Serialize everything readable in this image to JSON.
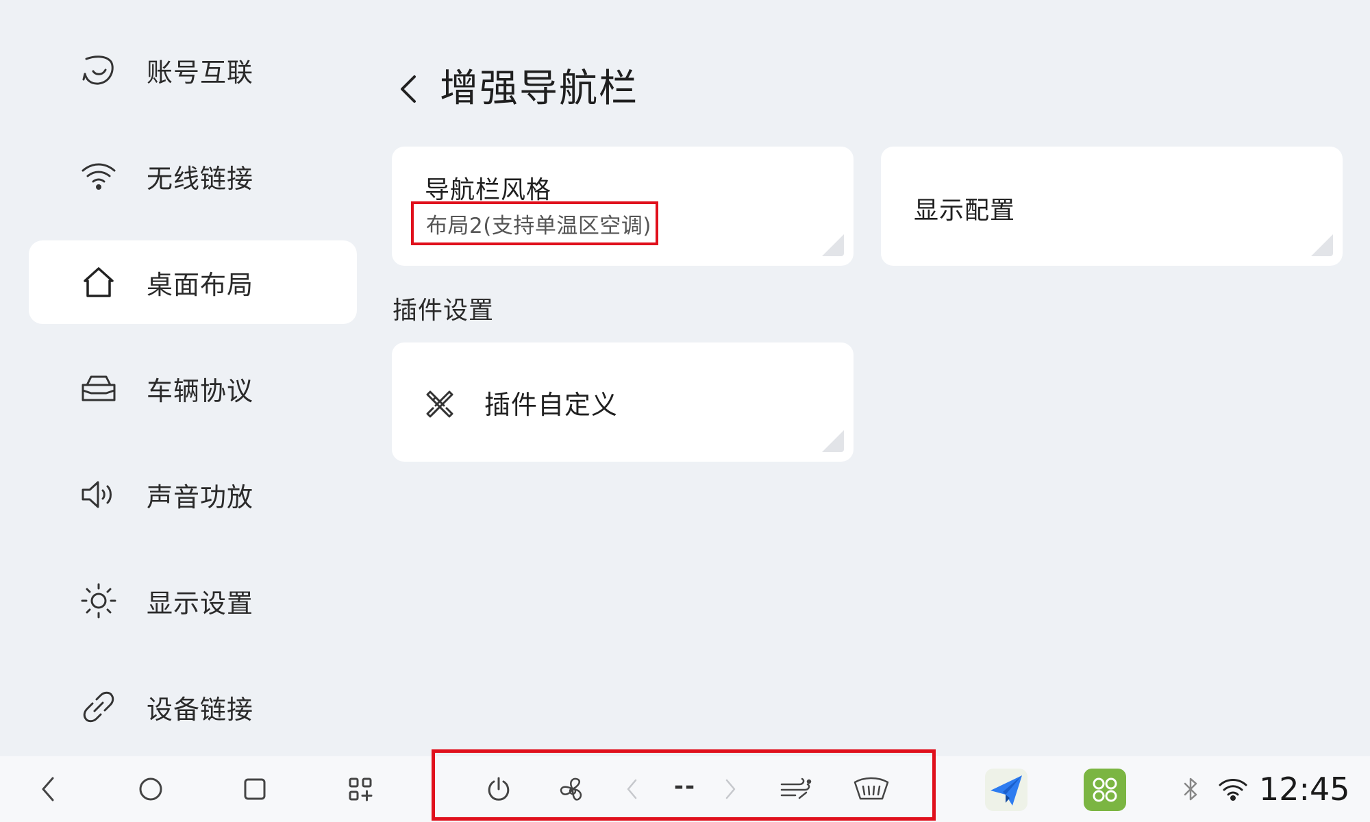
{
  "sidebar": {
    "items": [
      {
        "label": "账号互联",
        "icon": "account-link-icon"
      },
      {
        "label": "无线链接",
        "icon": "wifi-icon"
      },
      {
        "label": "桌面布局",
        "icon": "home-icon",
        "active": true
      },
      {
        "label": "车辆协议",
        "icon": "car-icon"
      },
      {
        "label": "声音功放",
        "icon": "speaker-icon"
      },
      {
        "label": "显示设置",
        "icon": "brightness-icon"
      },
      {
        "label": "设备链接",
        "icon": "link-icon"
      }
    ]
  },
  "header": {
    "title": "增强导航栏"
  },
  "cards": {
    "nav_style": {
      "title": "导航栏风格",
      "value": "布局2(支持单温区空调)"
    },
    "display_config": {
      "title": "显示配置"
    },
    "plugin_section_label": "插件设置",
    "plugin_custom": {
      "title": "插件自定义",
      "icon": "plugin-icon"
    }
  },
  "navbar": {
    "temperature": "--",
    "time": "12:45",
    "app_icons": [
      "navigation-app-icon",
      "apps-grid-app-icon"
    ],
    "status_icons": [
      "bluetooth-icon",
      "wifi-status-icon"
    ]
  },
  "colors": {
    "highlight": "#e0101c",
    "background": "#eef1f5",
    "card": "#ffffff",
    "app_green": "#7bb542"
  }
}
